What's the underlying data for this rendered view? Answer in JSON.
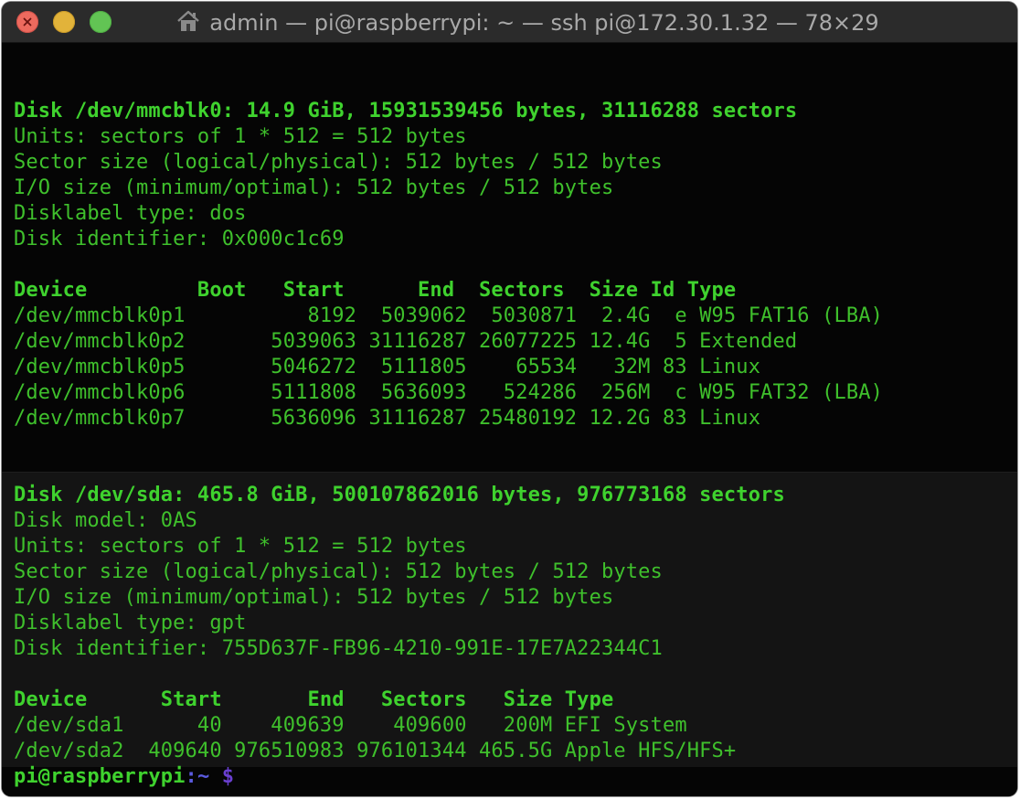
{
  "window": {
    "title": "admin — pi@raspberrypi: ~ — ssh pi@172.30.1.32 — 78×29"
  },
  "terminal": {
    "disk1": {
      "header": "Disk /dev/mmcblk0: 14.9 GiB, 15931539456 bytes, 31116288 sectors",
      "info": [
        "Units: sectors of 1 * 512 = 512 bytes",
        "Sector size (logical/physical): 512 bytes / 512 bytes",
        "I/O size (minimum/optimal): 512 bytes / 512 bytes",
        "Disklabel type: dos",
        "Disk identifier: 0x000c1c69"
      ],
      "table_header": "Device         Boot   Start      End  Sectors  Size Id Type",
      "rows": [
        "/dev/mmcblk0p1          8192  5039062  5030871  2.4G  e W95 FAT16 (LBA)",
        "/dev/mmcblk0p2       5039063 31116287 26077225 12.4G  5 Extended",
        "/dev/mmcblk0p5       5046272  5111805    65534   32M 83 Linux",
        "/dev/mmcblk0p6       5111808  5636093   524286  256M  c W95 FAT32 (LBA)",
        "/dev/mmcblk0p7       5636096 31116287 25480192 12.2G 83 Linux"
      ]
    },
    "disk2": {
      "header": "Disk /dev/sda: 465.8 GiB, 500107862016 bytes, 976773168 sectors",
      "info": [
        "Disk model: 0AS",
        "Units: sectors of 1 * 512 = 512 bytes",
        "Sector size (logical/physical): 512 bytes / 512 bytes",
        "I/O size (minimum/optimal): 512 bytes / 512 bytes",
        "Disklabel type: gpt",
        "Disk identifier: 755D637F-FB96-4210-991E-17E7A22344C1"
      ],
      "table_header": "Device      Start       End   Sectors   Size Type",
      "rows": [
        "/dev/sda1      40    409639    409600   200M EFI System",
        "/dev/sda2  409640 976510983 976101344 465.5G Apple HFS/HFS+"
      ]
    },
    "prompt": {
      "user_host": "pi@raspberrypi",
      "path": ":~",
      "sigil": "$"
    }
  },
  "colors": {
    "text_green": "#3fc02c",
    "bold_green": "#3fd22e",
    "prompt_path": "#5b5be0",
    "prompt_sigil": "#6a3fd0",
    "close": "#ed6a5e",
    "minimize": "#e2b33a",
    "maximize": "#62c454"
  },
  "icons": {
    "title_icon": "home-icon"
  }
}
